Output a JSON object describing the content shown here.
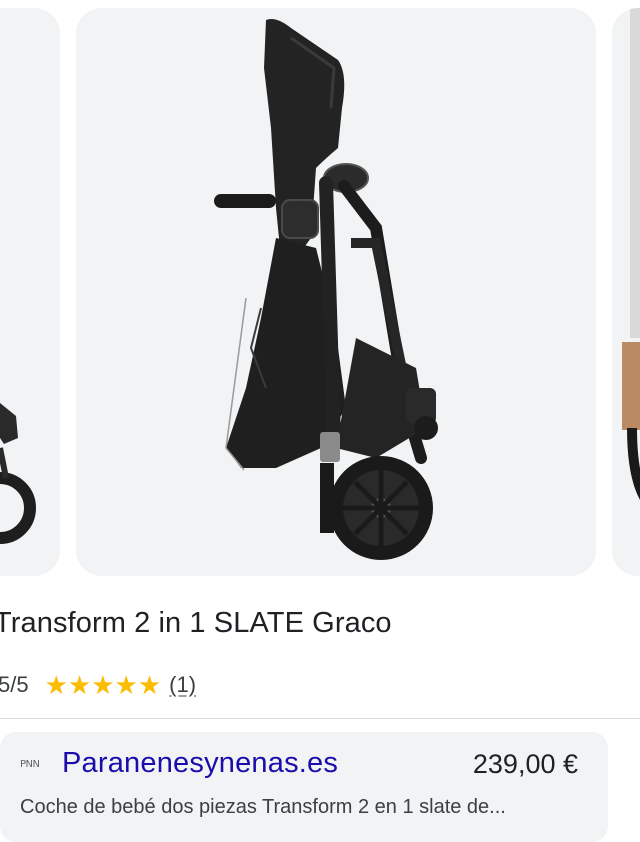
{
  "product": {
    "title": "Transform 2 in 1 SLATE Graco",
    "rating_text": "5/5",
    "stars": 5,
    "review_count_text": "(1)"
  },
  "offer": {
    "merchant_logo_text": "PNN",
    "merchant_name": "Paranenesynenas.es",
    "price": "239,00 €",
    "description": "Coche de bebé dos piezas Transform 2 en 1 slate de..."
  },
  "colors": {
    "card_bg": "#f1f3f4",
    "star": "#fbbc04",
    "link": "#1a0dab"
  },
  "icons": [
    "star-icon",
    "merchant-logo"
  ]
}
